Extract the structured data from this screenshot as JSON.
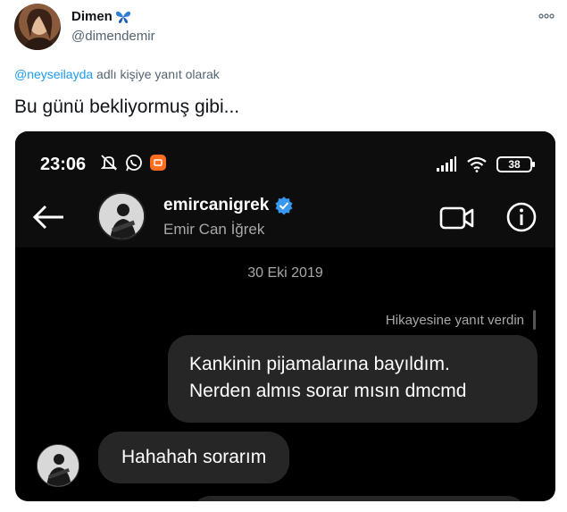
{
  "tweet": {
    "author_name": "Dimen",
    "author_handle": "@dimendemir",
    "reply_mention": "@neyseilayda",
    "reply_suffix": "adlı kişiye yanıt olarak",
    "text": "Bu günü bekliyormuş gibi..."
  },
  "phone": {
    "status_time": "23:06",
    "battery_level": "38"
  },
  "chat": {
    "username": "emircanigrek",
    "full_name": "Emir Can İğrek",
    "date": "30 Eki 2019",
    "story_reply_label": "Hikayesine yanıt verdin",
    "messages": [
      {
        "side": "sent",
        "lines": [
          "Kankinin pijamalarına bayıldım.",
          "Nerden almıs sorar mısın dmcmd"
        ]
      },
      {
        "side": "received",
        "text": "Hahahah sorarım"
      }
    ]
  },
  "colors": {
    "link": "#1d9bf0",
    "secondary": "#536471",
    "verified": "#3897f0",
    "bubble": "#262626"
  },
  "icons": [
    "butterfly-icon",
    "more-icon",
    "mute-icon",
    "whatsapp-icon",
    "app-icon",
    "signal-icon",
    "wifi-icon",
    "back-arrow-icon",
    "verified-icon",
    "video-call-icon",
    "info-icon"
  ]
}
